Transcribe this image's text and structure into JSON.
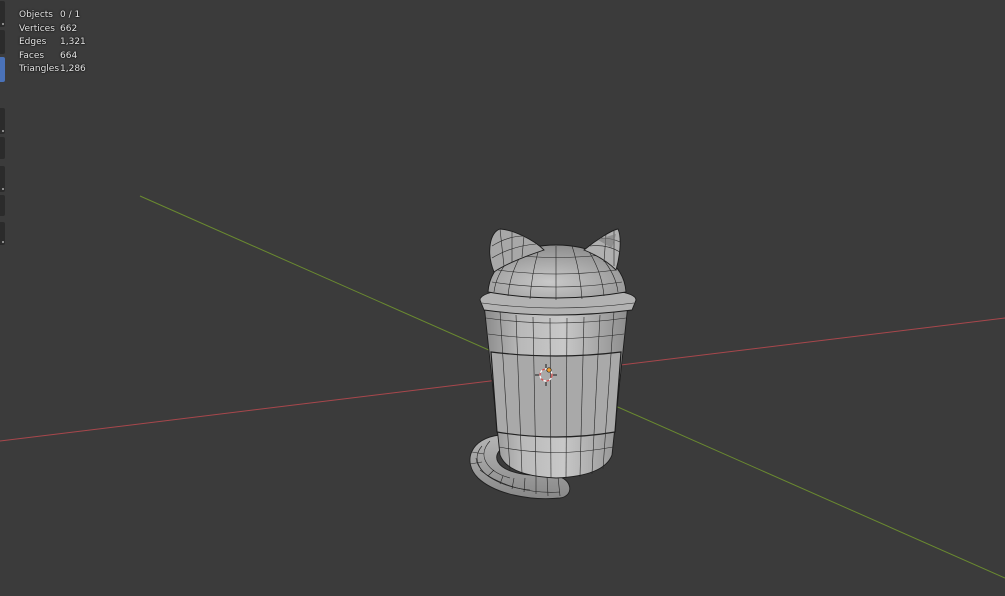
{
  "stats": [
    {
      "label": "Objects",
      "value": "0 / 1"
    },
    {
      "label": "Vertices",
      "value": "662"
    },
    {
      "label": "Edges",
      "value": "1,321"
    },
    {
      "label": "Faces",
      "value": "664"
    },
    {
      "label": "Triangles",
      "value": "1,286"
    }
  ],
  "colors": {
    "background": "#3b3b3b",
    "x_axis": "#a8474c",
    "y_axis": "#6a8a30",
    "active_tool": "#4a72b8",
    "stats_text": "#e6e6e6"
  },
  "icons": {
    "origin": "object-origin-icon",
    "cursor": "3d-cursor-icon"
  }
}
